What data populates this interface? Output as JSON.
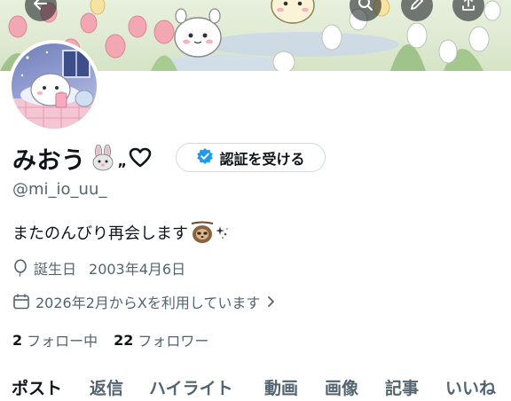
{
  "profile": {
    "display_name": "みおう",
    "name_suffix": "„",
    "handle": "@mi_io_uu_",
    "bio": "またのんびり再会します",
    "birth_label": "誕生日",
    "birth_value": "2003年4月6日",
    "joined": "2026年2月からXを利用しています",
    "following_count": "2",
    "following_label": "フォロー中",
    "followers_count": "22",
    "followers_label": "フォロワー"
  },
  "verify_button": {
    "label": "認証を受ける"
  },
  "tabs": [
    {
      "label": "ポスト",
      "active": true
    },
    {
      "label": "返信",
      "active": false
    },
    {
      "label": "ハイライト",
      "active": false
    },
    {
      "label": "動画",
      "active": false
    },
    {
      "label": "画像",
      "active": false
    },
    {
      "label": "記事",
      "active": false
    },
    {
      "label": "いいね",
      "active": false
    }
  ],
  "icons": {
    "top_bar": [
      "back-arrow-icon",
      "search-icon",
      "edit-icon",
      "share-icon"
    ],
    "birthday": "balloon-icon",
    "joined": "calendar-icon",
    "verify": "verified-badge-icon",
    "name": [
      "rabbit-icon",
      "heart-icon"
    ],
    "bio": [
      "sloth-icon",
      "sparkle-icon"
    ]
  },
  "colors": {
    "verified_blue": "#1d9bf0",
    "text_primary": "#0f1419",
    "text_secondary": "#536471"
  }
}
